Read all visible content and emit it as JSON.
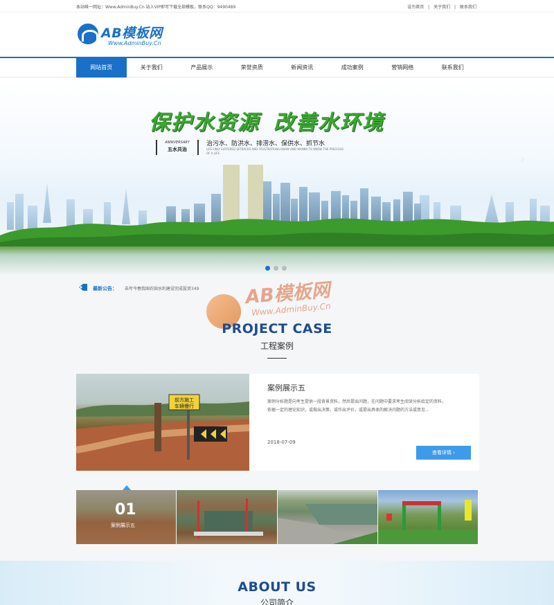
{
  "topbar": {
    "notice": "本站唯一网址：Www.AdminBuy.Cn 站入VIP即可下载全部模板，联系QQ：9490489",
    "links": [
      "设为首页",
      "|",
      "关于我们",
      "|",
      "联系我们"
    ]
  },
  "logo": {
    "name": "AB模板网",
    "sub": "Www.AdminBuy.Cn"
  },
  "nav": {
    "items": [
      {
        "label": "网站首页"
      },
      {
        "label": "关于我们"
      },
      {
        "label": "产品展示"
      },
      {
        "label": "荣誉资质"
      },
      {
        "label": "新闻资讯"
      },
      {
        "label": "成功案例"
      },
      {
        "label": "营销网络"
      },
      {
        "label": "联系我们"
      }
    ]
  },
  "banner": {
    "title_left": "保护水资源",
    "title_right": "改善水环境",
    "stamp_en": "ANNIVERSARY",
    "stamp_cn": "五水共治",
    "subtitle": "治污水、防洪水、排涝水、保供水、抓节水",
    "subtitle_en": "LIFE ONLY SUFFERED SETBACKS AND FRUSTRATIONS KNOW AND WANNA TO KNOW THE PRECIOUS OF A LIFE",
    "arrow": "›"
  },
  "announcement": {
    "label": "最新公告：",
    "text": "去年今春我国农田水利建设完成投资349"
  },
  "watermark": {
    "name": "AB模板网",
    "sub": "Www.AdminBuy.Cn"
  },
  "project": {
    "heading_en": "PROJECT CASE",
    "heading_cn": "工程案例"
  },
  "case": {
    "sign_text": "前方施工\n车辆慢行",
    "title": "案例展示五",
    "desc": "案例分析题是向考生提供一段背景资料，然后提出问题，在问题中要求考生阅读分析给定的资料，依据一定的理论知识，或做出决策，或作出评价，或提出具体的解决问题的方法或意见...",
    "date": "2018-07-09",
    "btn": "查看详情 ›"
  },
  "thumbs": {
    "active_num": "01",
    "active_label": "案例展示五"
  },
  "about": {
    "heading_en": "ABOUT US",
    "heading_cn": "公司简介"
  },
  "colors": {
    "brand": "#1a6fc9",
    "accent": "#3d9be9",
    "heading": "#1d4c8f"
  }
}
